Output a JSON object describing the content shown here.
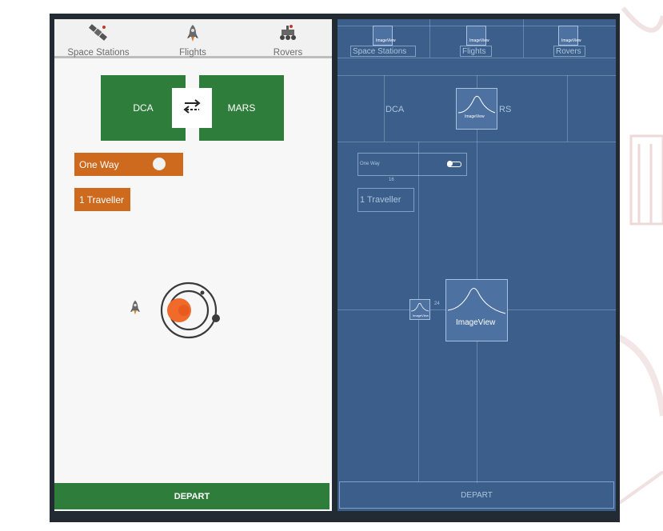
{
  "tabs": [
    {
      "label": "Space Stations",
      "icon": "satellite-icon"
    },
    {
      "label": "Flights",
      "icon": "rocket-icon"
    },
    {
      "label": "Rovers",
      "icon": "rover-icon"
    }
  ],
  "route": {
    "from": "DCA",
    "to": "MARS",
    "swap_icon": "swap-arrows-icon"
  },
  "trip_toggle": {
    "label": "One Way",
    "on": false
  },
  "travellers": {
    "label": "1 Traveller"
  },
  "depart_label": "DEPART",
  "blueprint": {
    "tabs": [
      "Space Stations",
      "Flights",
      "Rovers"
    ],
    "tab_image_label": "ImageView",
    "route_from": "DCA",
    "route_to_fragment": "RS",
    "swap_label": "ImageView",
    "toggle_label": "One Way",
    "margin_label": "16",
    "travellers": "1 Traveller",
    "small_image_label": "ImageView",
    "margin_label_2": "24",
    "image_label": "ImageView",
    "depart": "DEPART"
  },
  "colors": {
    "green": "#2e7d3a",
    "orange": "#cd6a1e",
    "blueprint_bg": "#3b5f8a",
    "planet": "#f06a2a"
  }
}
